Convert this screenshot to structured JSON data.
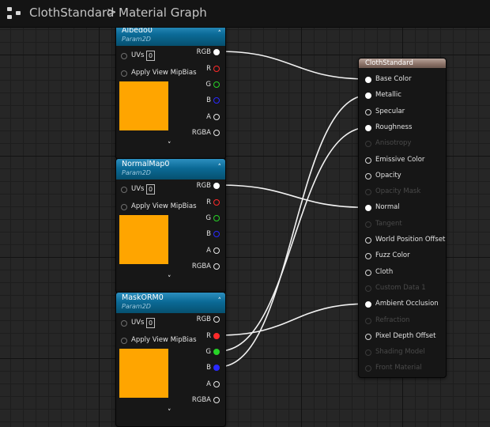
{
  "header": {
    "breadcrumb_root": "ClothStandard",
    "breadcrumb_separator": ">",
    "breadcrumb_current": "Material Graph"
  },
  "texture_nodes": [
    {
      "title": "Albedo0",
      "subtitle": "Param2D",
      "inputs": {
        "uvs_label": "UVs",
        "uvs_value": "0",
        "mipbias_label": "Apply View MipBias"
      },
      "outputs": [
        "RGB",
        "R",
        "G",
        "B",
        "A",
        "RGBA"
      ],
      "connected_outputs": [
        "RGB"
      ],
      "preview_color": "#ffa500"
    },
    {
      "title": "NormalMap0",
      "subtitle": "Param2D",
      "inputs": {
        "uvs_label": "UVs",
        "uvs_value": "0",
        "mipbias_label": "Apply View MipBias"
      },
      "outputs": [
        "RGB",
        "R",
        "G",
        "B",
        "A",
        "RGBA"
      ],
      "connected_outputs": [
        "RGB"
      ],
      "preview_color": "#ffa500"
    },
    {
      "title": "MaskORM0",
      "subtitle": "Param2D",
      "inputs": {
        "uvs_label": "UVs",
        "uvs_value": "0",
        "mipbias_label": "Apply View MipBias"
      },
      "outputs": [
        "RGB",
        "R",
        "G",
        "B",
        "A",
        "RGBA"
      ],
      "connected_outputs": [
        "R",
        "G",
        "B"
      ],
      "preview_color": "#ffa500"
    }
  ],
  "material_node": {
    "title": "ClothStandard",
    "pins": [
      {
        "label": "Base Color",
        "state": "connected"
      },
      {
        "label": "Metallic",
        "state": "connected"
      },
      {
        "label": "Specular",
        "state": "enabled"
      },
      {
        "label": "Roughness",
        "state": "connected"
      },
      {
        "label": "Anisotropy",
        "state": "disabled"
      },
      {
        "label": "Emissive Color",
        "state": "enabled"
      },
      {
        "label": "Opacity",
        "state": "enabled"
      },
      {
        "label": "Opacity Mask",
        "state": "disabled"
      },
      {
        "label": "Normal",
        "state": "connected"
      },
      {
        "label": "Tangent",
        "state": "disabled"
      },
      {
        "label": "World Position Offset",
        "state": "enabled"
      },
      {
        "label": "Fuzz Color",
        "state": "enabled"
      },
      {
        "label": "Cloth",
        "state": "enabled"
      },
      {
        "label": "Custom Data 1",
        "state": "disabled"
      },
      {
        "label": "Ambient Occlusion",
        "state": "connected"
      },
      {
        "label": "Refraction",
        "state": "disabled"
      },
      {
        "label": "Pixel Depth Offset",
        "state": "enabled"
      },
      {
        "label": "Shading Model",
        "state": "disabled"
      },
      {
        "label": "Front Material",
        "state": "disabled"
      }
    ]
  },
  "connections": [
    {
      "from": "Albedo0.RGB",
      "to": "Base Color"
    },
    {
      "from": "NormalMap0.RGB",
      "to": "Normal"
    },
    {
      "from": "MaskORM0.R",
      "to": "Ambient Occlusion"
    },
    {
      "from": "MaskORM0.G",
      "to": "Roughness"
    },
    {
      "from": "MaskORM0.B",
      "to": "Metallic"
    }
  ]
}
